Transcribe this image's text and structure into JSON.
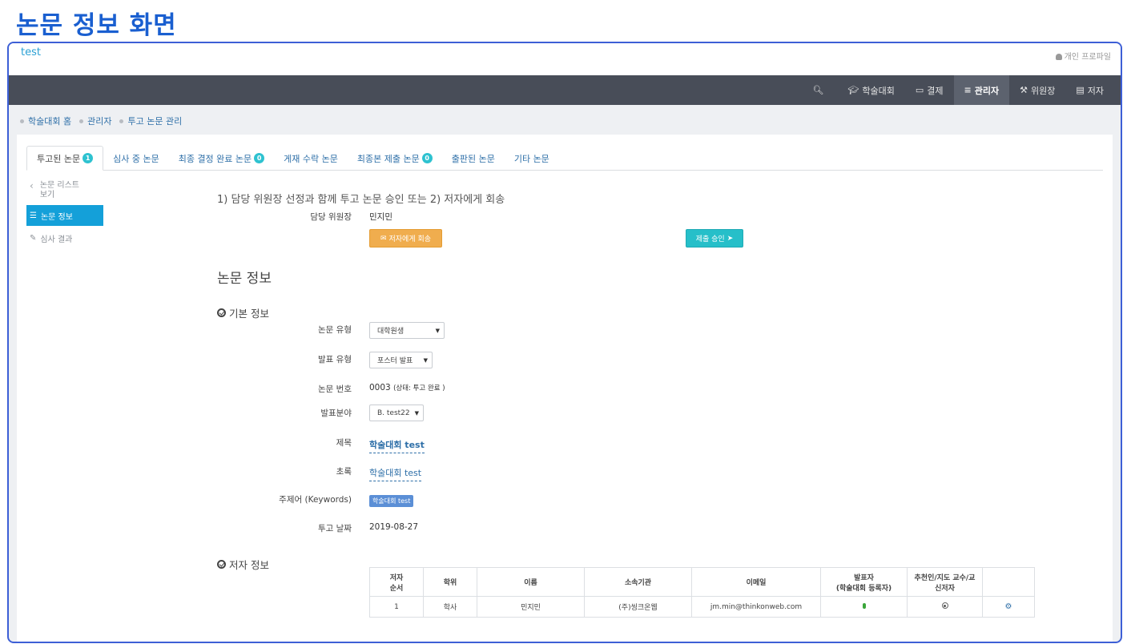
{
  "page_heading": "논문 정보 화면",
  "topbar": {
    "brand": "test",
    "profile_label": "개인 프로파일"
  },
  "navbar": {
    "items": [
      {
        "label": "",
        "icon": "search-icon"
      },
      {
        "label": "학술대회",
        "icon": "graduation-cap-icon"
      },
      {
        "label": "결제",
        "icon": "credit-card-icon"
      },
      {
        "label": "관리자",
        "icon": "list-icon",
        "active": true
      },
      {
        "label": "위원장",
        "icon": "gavel-icon"
      },
      {
        "label": "저자",
        "icon": "book-icon"
      }
    ]
  },
  "breadcrumb": [
    "학술대회 홈",
    "관리자",
    "투고 논문 관리"
  ],
  "tabs": [
    {
      "label": "투고된 논문",
      "badge": "1",
      "active": true
    },
    {
      "label": "심사 중 논문",
      "badge": ""
    },
    {
      "label": "최종 결정 완료 논문",
      "badge": "0"
    },
    {
      "label": "게재 수락 논문",
      "badge": ""
    },
    {
      "label": "최종본 제출 논문",
      "badge": "0"
    },
    {
      "label": "출판된 논문",
      "badge": ""
    },
    {
      "label": "기타 논문",
      "badge": ""
    }
  ],
  "side": {
    "back_label_1": "논문 리스트",
    "back_label_2": "보기",
    "items": [
      {
        "label": "논문 정보",
        "active": true
      },
      {
        "label": "심사 결과",
        "active": false
      }
    ]
  },
  "step": {
    "title": "1) 담당 위원장 선정과 함께 투고 논문 승인 또는 2) 저자에게 회송",
    "chair_label": "담당 위원장",
    "chair_value": "민지민",
    "return_button": "저자에게 회송",
    "approve_button": "제출 승인"
  },
  "paper": {
    "section_title": "논문 정보",
    "basic_title": "기본 정보",
    "type_label": "논문 유형",
    "type_value": "대학원생",
    "present_label": "발표 유형",
    "present_value": "포스터 발표",
    "number_label": "논문 번호",
    "number_value": "0003",
    "number_status": "(상태: 투고 완료 )",
    "field_label": "발표분야",
    "field_value": "B. test22",
    "title_label": "제목",
    "title_value": "학술대회 test",
    "abstract_label": "초록",
    "abstract_value": "학술대회 test",
    "keywords_label": "주제어 (Keywords)",
    "keyword_value": "학술대회 test",
    "date_label": "투고 날짜",
    "date_value": "2019-08-27"
  },
  "authors": {
    "section_title": "저자 정보",
    "headers": [
      "저자\n순서",
      "학위",
      "이름",
      "소속기관",
      "이메일",
      "발표자\n(학술대회 등록자)",
      "추천인/지도 교수/교\n신저자",
      ""
    ],
    "rows": [
      {
        "order": "1",
        "degree": "학사",
        "name": "민지민",
        "org": "(주)씽크온웹",
        "email": "jm.min@thinkonweb.com"
      }
    ]
  }
}
